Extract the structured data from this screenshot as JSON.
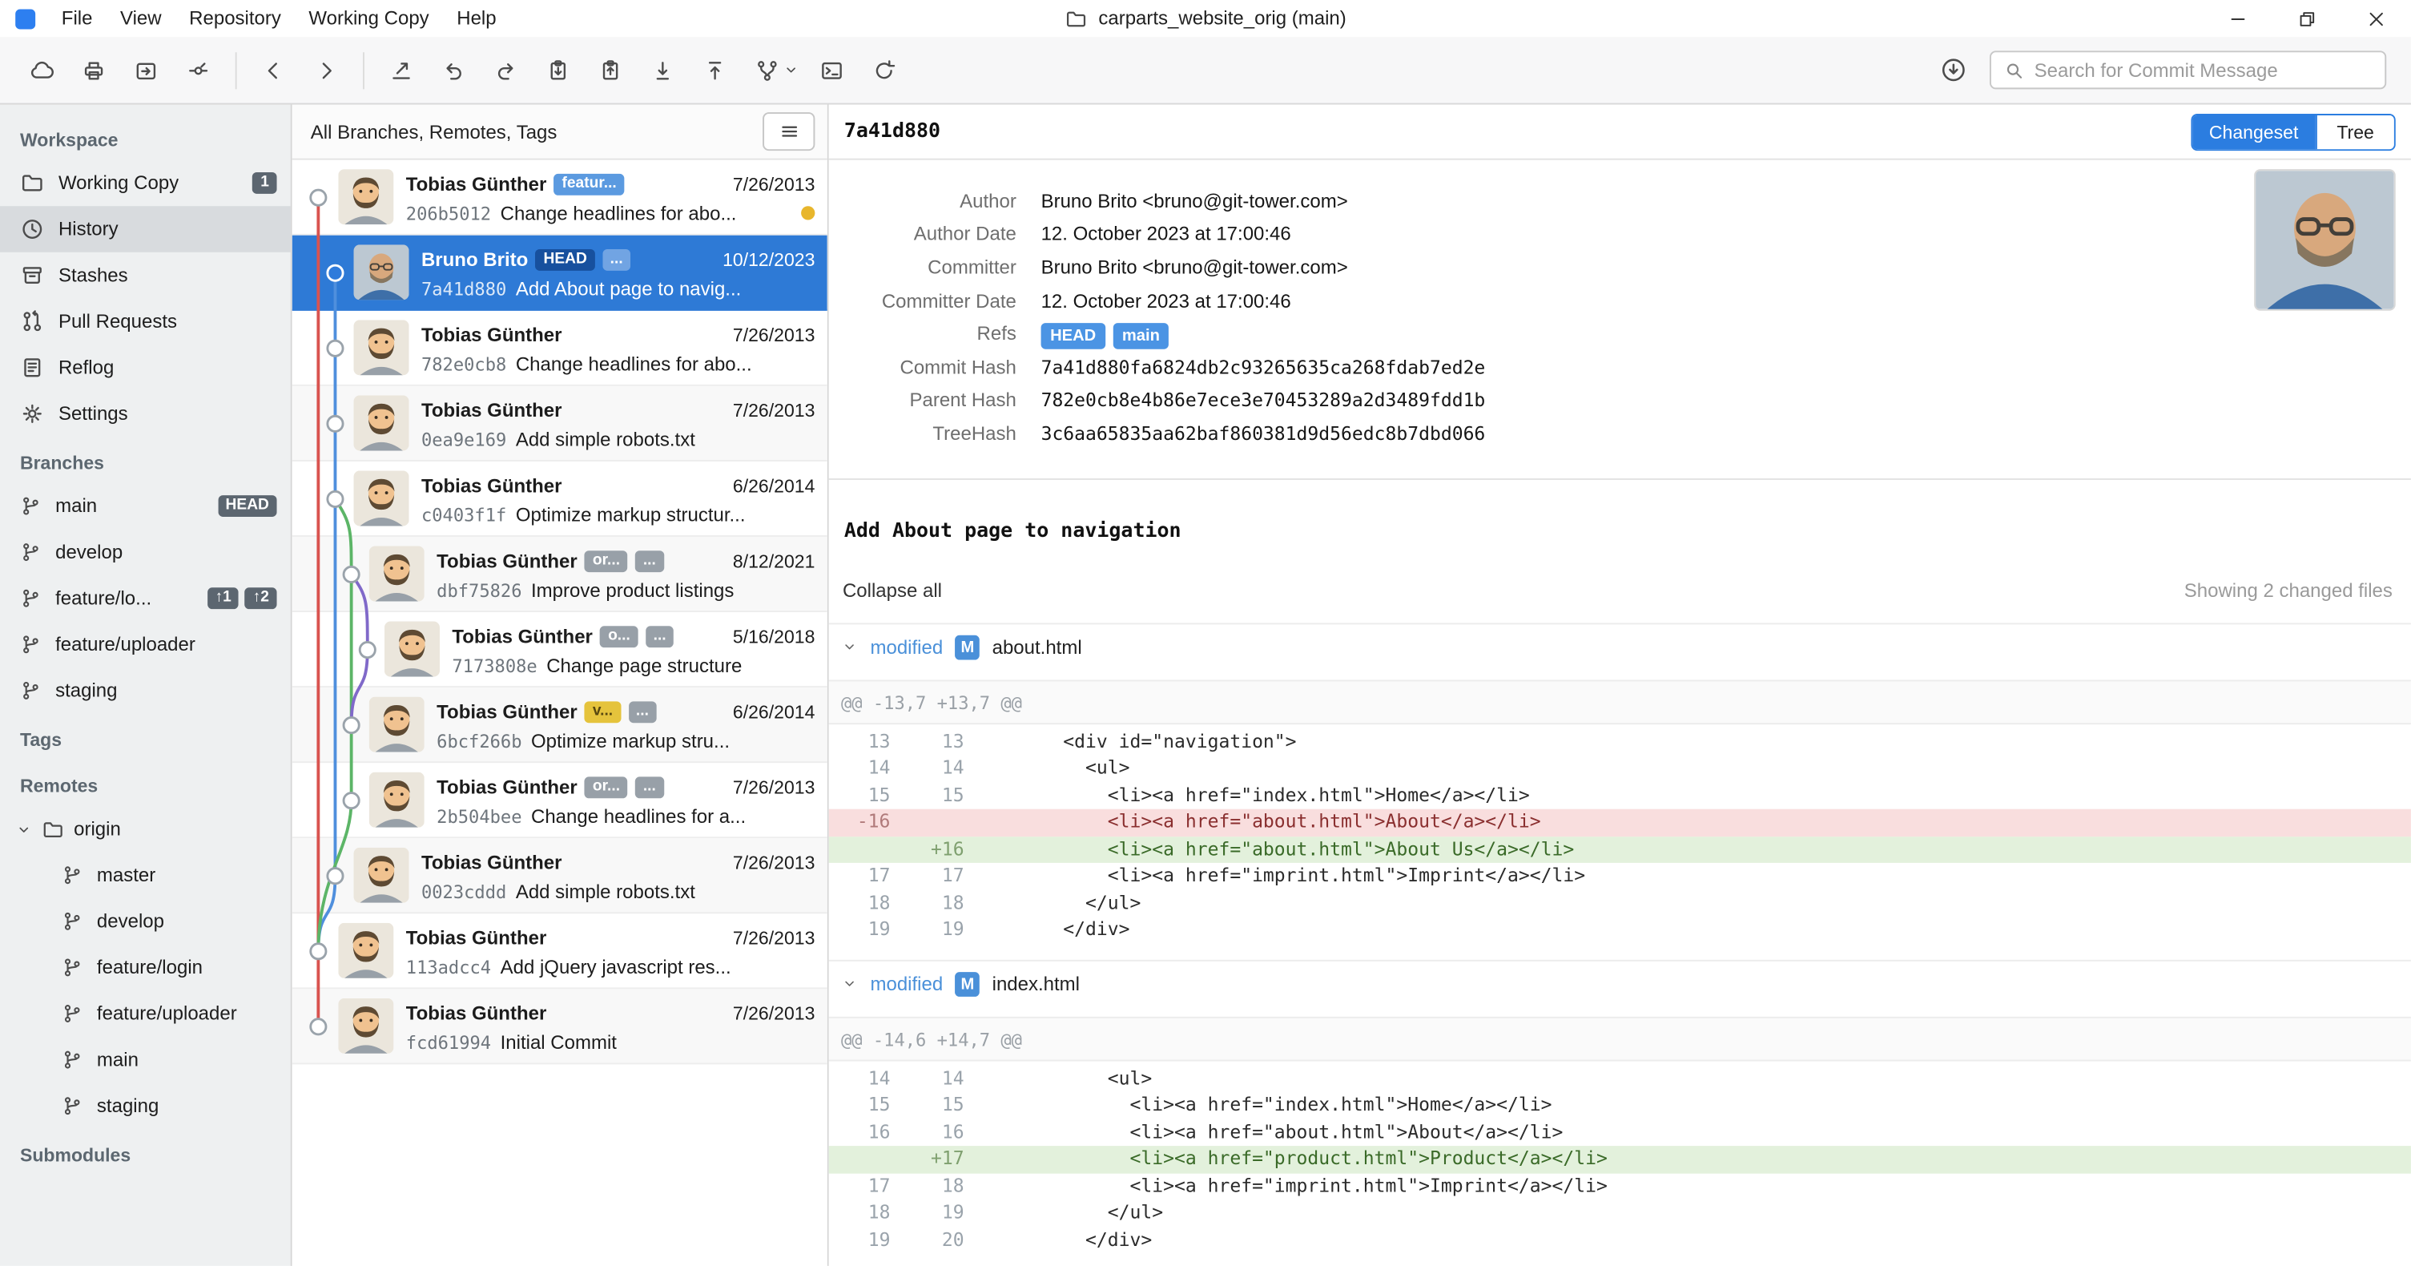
{
  "titlebar": {
    "menu_items": [
      "File",
      "View",
      "Repository",
      "Working Copy",
      "Help"
    ],
    "title": "carparts_website_orig (main)"
  },
  "toolbar": {
    "buttons": [
      {
        "icon": "cloud"
      },
      {
        "icon": "printer"
      },
      {
        "icon": "open-external"
      },
      {
        "icon": "commit-graph"
      },
      {
        "icon": "back"
      },
      {
        "icon": "forward"
      },
      {
        "icon": "checkout"
      },
      {
        "icon": "undo"
      },
      {
        "icon": "redo"
      },
      {
        "icon": "stash-save"
      },
      {
        "icon": "stash-apply"
      },
      {
        "icon": "pull"
      },
      {
        "icon": "push"
      },
      {
        "icon": "merge"
      },
      {
        "icon": "terminal"
      },
      {
        "icon": "refresh"
      }
    ],
    "search": {
      "placeholder": "Search for Commit Message"
    }
  },
  "sidebar": {
    "sections": [
      {
        "title": "Workspace",
        "items": [
          {
            "label": "Working Copy",
            "icon": "folder",
            "badge": "1"
          },
          {
            "label": "History",
            "icon": "clock",
            "selected": true
          },
          {
            "label": "Stashes",
            "icon": "archive"
          },
          {
            "label": "Pull Requests",
            "icon": "pull-request"
          },
          {
            "label": "Reflog",
            "icon": "journal"
          },
          {
            "label": "Settings",
            "icon": "gear"
          }
        ]
      },
      {
        "title": "Branches",
        "items": [
          {
            "label": "main",
            "icon": "branch",
            "badge": "HEAD"
          },
          {
            "label": "develop",
            "icon": "branch"
          },
          {
            "label": "feature/lo...",
            "icon": "branch",
            "badges": [
              "↑1",
              "↑2"
            ]
          },
          {
            "label": "feature/uploader",
            "icon": "branch"
          },
          {
            "label": "staging",
            "icon": "branch"
          }
        ]
      },
      {
        "title": "Tags",
        "items": []
      },
      {
        "title": "Remotes",
        "items": [
          {
            "label": "origin",
            "icon": "remote-folder",
            "expanded": true,
            "children": [
              {
                "label": "master",
                "icon": "branch"
              },
              {
                "label": "develop",
                "icon": "branch"
              },
              {
                "label": "feature/login",
                "icon": "branch"
              },
              {
                "label": "feature/uploader",
                "icon": "branch"
              },
              {
                "label": "main",
                "icon": "branch"
              },
              {
                "label": "staging",
                "icon": "branch"
              }
            ]
          }
        ]
      },
      {
        "title": "Submodules",
        "items": []
      }
    ]
  },
  "commit_list": {
    "filter_label": "All Branches, Remotes, Tags",
    "commits": [
      {
        "author": "Tobias Günther",
        "badges": [
          {
            "text": "featur...",
            "style": "blue"
          }
        ],
        "date": "7/26/2013",
        "hash": "206b5012",
        "message": "Change headlines for abo...",
        "marker": "yellow-dot",
        "lane": 0,
        "avatar": "tobias-cartoon"
      },
      {
        "author": "Bruno Brito",
        "badges": [
          {
            "text": "HEAD",
            "style": "head"
          },
          {
            "text": "...",
            "style": "gray"
          }
        ],
        "date": "10/12/2023",
        "hash": "7a41d880",
        "message": "Add About page to navig...",
        "selected": true,
        "lane": 1,
        "avatar": "bruno-photo"
      },
      {
        "author": "Tobias Günther",
        "date": "7/26/2013",
        "hash": "782e0cb8",
        "message": "Change headlines for abo...",
        "lane": 1,
        "avatar": "tobias-cartoon"
      },
      {
        "author": "Tobias Günther",
        "date": "7/26/2013",
        "hash": "0ea9e169",
        "message": "Add simple robots.txt",
        "lane": 1,
        "avatar": "tobias-cartoon"
      },
      {
        "author": "Tobias Günther",
        "date": "6/26/2014",
        "hash": "c0403f1f",
        "message": "Optimize markup structur...",
        "lane": 1,
        "avatar": "tobias-cartoon"
      },
      {
        "author": "Tobias Günther",
        "badges": [
          {
            "text": "or...",
            "style": "gray"
          },
          {
            "text": "...",
            "style": "gray"
          }
        ],
        "date": "8/12/2021",
        "hash": "dbf75826",
        "message": "Improve product listings",
        "lane": 2,
        "avatar": "tobias-cartoon"
      },
      {
        "author": "Tobias Günther",
        "badges": [
          {
            "text": "o...",
            "style": "gray"
          },
          {
            "text": "...",
            "style": "gray"
          }
        ],
        "date": "5/16/2018",
        "hash": "7173808e",
        "message": "Change page structure",
        "lane": 3,
        "avatar": "tobias-cartoon"
      },
      {
        "author": "Tobias Günther",
        "badges": [
          {
            "text": "v...",
            "style": "yellow"
          },
          {
            "text": "...",
            "style": "gray"
          }
        ],
        "date": "6/26/2014",
        "hash": "6bcf266b",
        "message": "Optimize markup stru...",
        "lane": 2,
        "avatar": "tobias-cartoon"
      },
      {
        "author": "Tobias Günther",
        "badges": [
          {
            "text": "or...",
            "style": "gray"
          },
          {
            "text": "...",
            "style": "gray"
          }
        ],
        "date": "7/26/2013",
        "hash": "2b504bee",
        "message": "Change headlines for a...",
        "lane": 2,
        "avatar": "tobias-cartoon"
      },
      {
        "author": "Tobias Günther",
        "date": "7/26/2013",
        "hash": "0023cddd",
        "message": "Add simple robots.txt",
        "lane": 1,
        "avatar": "tobias-cartoon"
      },
      {
        "author": "Tobias Günther",
        "date": "7/26/2013",
        "hash": "113adcc4",
        "message": "Add jQuery javascript res...",
        "lane": 0,
        "avatar": "tobias-cartoon"
      },
      {
        "author": "Tobias Günther",
        "date": "7/26/2013",
        "hash": "fcd61994",
        "message": "Initial Commit",
        "lane": 0,
        "avatar": "tobias-cartoon"
      }
    ]
  },
  "detail": {
    "short_hash": "7a41d880",
    "tabs": {
      "changeset": "Changeset",
      "tree": "Tree"
    },
    "fields": {
      "author_label": "Author",
      "author": "Bruno Brito <bruno@git-tower.com>",
      "author_date_label": "Author Date",
      "author_date": "12. October 2023 at 17:00:46",
      "committer_label": "Committer",
      "committer": "Bruno Brito <bruno@git-tower.com>",
      "committer_date_label": "Committer Date",
      "committer_date": "12. October 2023 at 17:00:46",
      "refs_label": "Refs",
      "commit_hash_label": "Commit Hash",
      "commit_hash": "7a41d880fa6824db2c93265635ca268fdab7ed2e",
      "parent_hash_label": "Parent Hash",
      "parent_hash": "782e0cb8e4b86e7ece3e70453289a2d3489fdd1b",
      "tree_hash_label": "TreeHash",
      "tree_hash": "3c6aa65835aa62baf860381d9d56edc8b7dbd066"
    },
    "refs": [
      "HEAD",
      "main"
    ],
    "avatar": "bruno-photo",
    "message": "Add About page to navigation",
    "collapse_all": "Collapse all",
    "files_summary": "Showing 2 changed files",
    "files": [
      {
        "status": "modified",
        "badge": "M",
        "name": "about.html",
        "hunk": "@@ -13,7 +13,7 @@",
        "lines": [
          {
            "old": "13",
            "new": "13",
            "type": "ctx",
            "code": "  <div id=\"navigation\">"
          },
          {
            "old": "14",
            "new": "14",
            "type": "ctx",
            "code": "    <ul>"
          },
          {
            "old": "15",
            "new": "15",
            "type": "ctx",
            "code": "      <li><a href=\"index.html\">Home</a></li>"
          },
          {
            "old": "-16",
            "new": "",
            "type": "del",
            "code": "      <li><a href=\"about.html\">About</a></li>"
          },
          {
            "old": "",
            "new": "+16",
            "type": "add",
            "code": "      <li><a href=\"about.html\">About Us</a></li>"
          },
          {
            "old": "17",
            "new": "17",
            "type": "ctx",
            "code": "      <li><a href=\"imprint.html\">Imprint</a></li>"
          },
          {
            "old": "18",
            "new": "18",
            "type": "ctx",
            "code": "    </ul>"
          },
          {
            "old": "19",
            "new": "19",
            "type": "ctx",
            "code": "  </div>"
          }
        ]
      },
      {
        "status": "modified",
        "badge": "M",
        "name": "index.html",
        "hunk": "@@ -14,6 +14,7 @@",
        "lines": [
          {
            "old": "14",
            "new": "14",
            "type": "ctx",
            "code": "      <ul>"
          },
          {
            "old": "15",
            "new": "15",
            "type": "ctx",
            "code": "        <li><a href=\"index.html\">Home</a></li>"
          },
          {
            "old": "16",
            "new": "16",
            "type": "ctx",
            "code": "        <li><a href=\"about.html\">About</a></li>"
          },
          {
            "old": "",
            "new": "+17",
            "type": "add",
            "code": "        <li><a href=\"product.html\">Product</a></li>"
          },
          {
            "old": "17",
            "new": "18",
            "type": "ctx",
            "code": "        <li><a href=\"imprint.html\">Imprint</a></li>"
          },
          {
            "old": "18",
            "new": "19",
            "type": "ctx",
            "code": "      </ul>"
          },
          {
            "old": "19",
            "new": "20",
            "type": "ctx",
            "code": "    </div>"
          }
        ]
      }
    ]
  }
}
